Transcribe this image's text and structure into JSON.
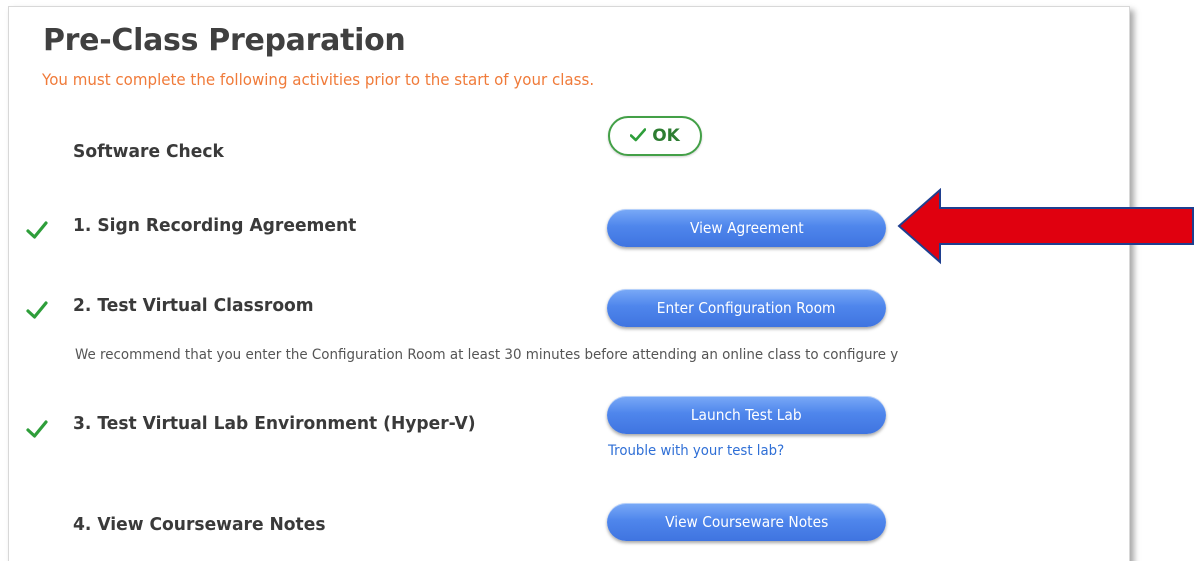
{
  "page": {
    "title": "Pre-Class Preparation",
    "subtitle": "You must complete the following activities prior to the start of your class."
  },
  "software_check": {
    "label": "Software Check",
    "status": "OK",
    "status_icon": "check-icon"
  },
  "items": [
    {
      "label": "1. Sign Recording Agreement",
      "completed": true,
      "button_label": "View Agreement"
    },
    {
      "label": "2. Test Virtual Classroom",
      "completed": true,
      "button_label": "Enter Configuration Room",
      "note": "We recommend that you enter the Configuration Room at least 30 minutes before attending an online class to configure y"
    },
    {
      "label": "3. Test Virtual Lab Environment (Hyper-V)",
      "completed": true,
      "button_label": "Launch Test Lab",
      "link_label": "Trouble with your test lab?"
    },
    {
      "label": "4. View Courseware Notes",
      "completed": false,
      "button_label": "View Courseware Notes"
    }
  ],
  "annotation": {
    "icon": "arrow-left-icon",
    "color": "#e0000f",
    "outline_color": "#1f3f8f"
  },
  "colors": {
    "title": "#404040",
    "subtitle": "#f07b3a",
    "check": "#2e9e3a",
    "button": "#4f86ec",
    "link": "#2f6fd6"
  }
}
